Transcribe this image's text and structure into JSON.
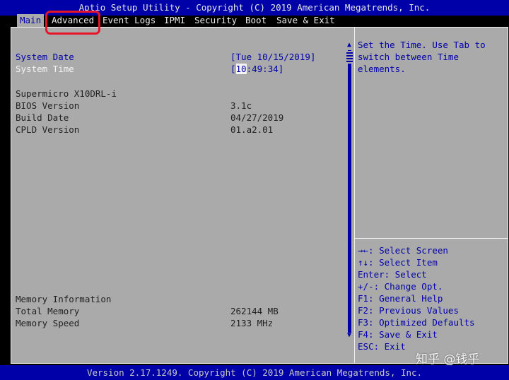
{
  "header": {
    "title": "Aptio Setup Utility - Copyright (C) 2019 American Megatrends, Inc."
  },
  "tabs": [
    {
      "label": "Main"
    },
    {
      "label": "Advanced"
    },
    {
      "label": "Event Logs"
    },
    {
      "label": "IPMI"
    },
    {
      "label": "Security"
    },
    {
      "label": "Boot"
    },
    {
      "label": "Save & Exit"
    }
  ],
  "main": {
    "system_date": {
      "label": "System Date",
      "value": "[Tue 10/15/2019]"
    },
    "system_time": {
      "label": "System Time",
      "value_prefix": "[",
      "value_cursor": "10",
      "value_rest": ":49:34]"
    },
    "model": "Supermicro X10DRL-i",
    "bios_version": {
      "label": "BIOS Version",
      "value": "3.1c"
    },
    "build_date": {
      "label": "Build Date",
      "value": "04/27/2019"
    },
    "cpld_version": {
      "label": "CPLD Version",
      "value": "01.a2.01"
    },
    "memory_info": "Memory Information",
    "total_memory": {
      "label": "Total Memory",
      "value": "262144 MB"
    },
    "memory_speed": {
      "label": "Memory Speed",
      "value": "2133 MHz"
    }
  },
  "help": {
    "lines": [
      "Set the Time. Use Tab to",
      "switch between Time",
      "elements."
    ]
  },
  "keys": [
    "→←: Select Screen",
    "↑↓: Select Item",
    "Enter: Select",
    "+/-: Change Opt.",
    "F1: General Help",
    "F2: Previous Values",
    "F3: Optimized Defaults",
    "F4: Save & Exit",
    "ESC: Exit"
  ],
  "footer": {
    "text": "Version 2.17.1249. Copyright (C) 2019 American Megatrends, Inc."
  },
  "watermark": "知乎 @钱乎",
  "colors": {
    "bios_blue": "#0000a8",
    "panel_gray": "#aaaaaa",
    "annotation_red": "#e8142a"
  },
  "icons": [
    "scroll-up-arrow-icon",
    "scroll-down-arrow-icon"
  ]
}
